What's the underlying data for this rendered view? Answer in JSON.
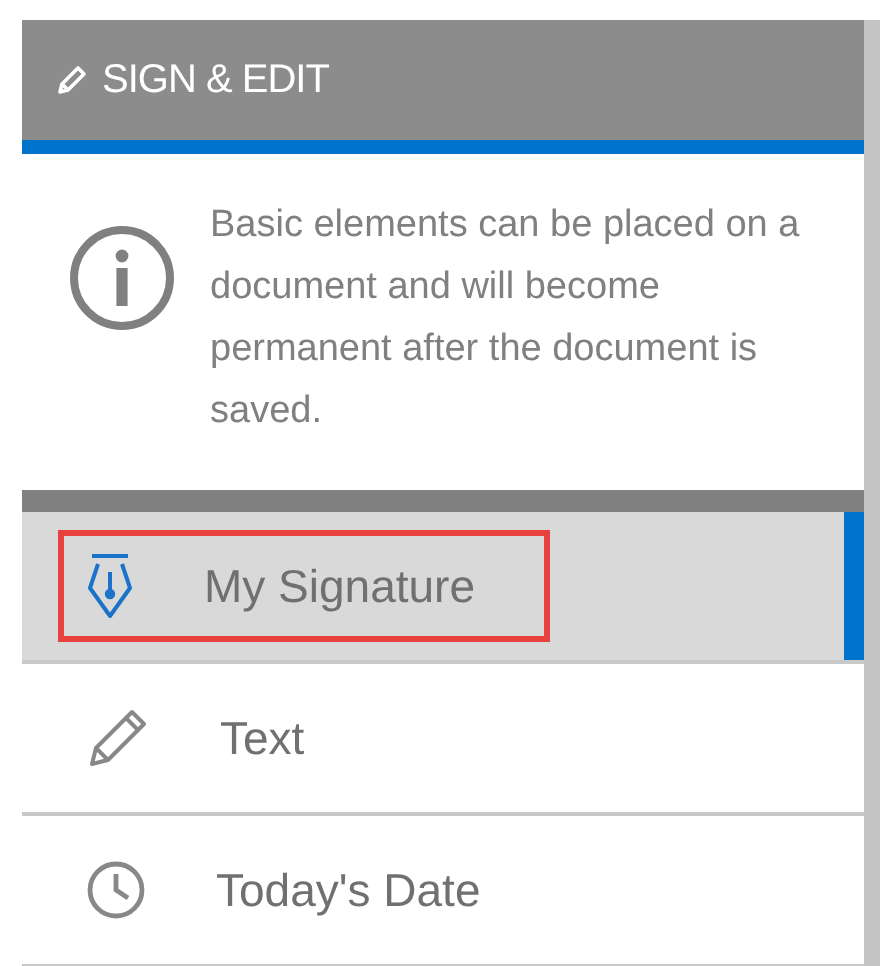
{
  "panel": {
    "title": "SIGN & EDIT",
    "info": "Basic elements can be placed on a document and will become permanent after the document is saved."
  },
  "items": [
    {
      "kind": "signature",
      "label": "My Signature",
      "selected": true,
      "annotated": true
    },
    {
      "kind": "text",
      "label": "Text",
      "selected": false,
      "annotated": false
    },
    {
      "kind": "date",
      "label": "Today's Date",
      "selected": false,
      "annotated": false
    }
  ]
}
